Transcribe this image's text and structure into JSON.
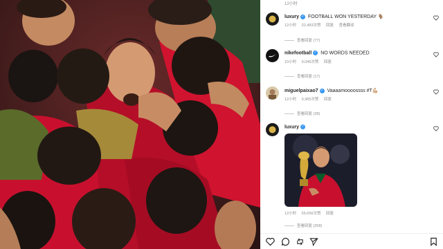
{
  "top": {
    "timestamp": "12小时"
  },
  "comments": [
    {
      "username": "luxury",
      "text": "FOOTBALL WON YESTERDAY 🐐",
      "time": "12小时",
      "likes": "32,483次赞",
      "reply": "回复",
      "translate": "查看翻译",
      "replies": "查看回复 (77)"
    },
    {
      "username": "nikefootball",
      "text": "NO WORDS NEEDED",
      "time": "10小时",
      "likes": "9,046次赞",
      "reply": "回复",
      "replies": "查看回复 (17)"
    },
    {
      "username": "miguelpaixao7",
      "text": "Vaaaamoooossss #T💪🏼",
      "time": "12小时",
      "likes": "9,985次赞",
      "reply": "回复",
      "replies": "查看回复 (28)"
    },
    {
      "username": "luxury",
      "text": "",
      "time": "12小时",
      "likes": "55,656次赞",
      "reply": "回复",
      "replies": "查看回复 (258)"
    }
  ],
  "actions": {
    "like": "heart-icon",
    "comment": "comment-icon",
    "share": "share-icon",
    "send": "send-icon",
    "save": "bookmark-icon"
  },
  "colors": {
    "verified": "#3897f0",
    "portugal_red": "#c8102e"
  }
}
